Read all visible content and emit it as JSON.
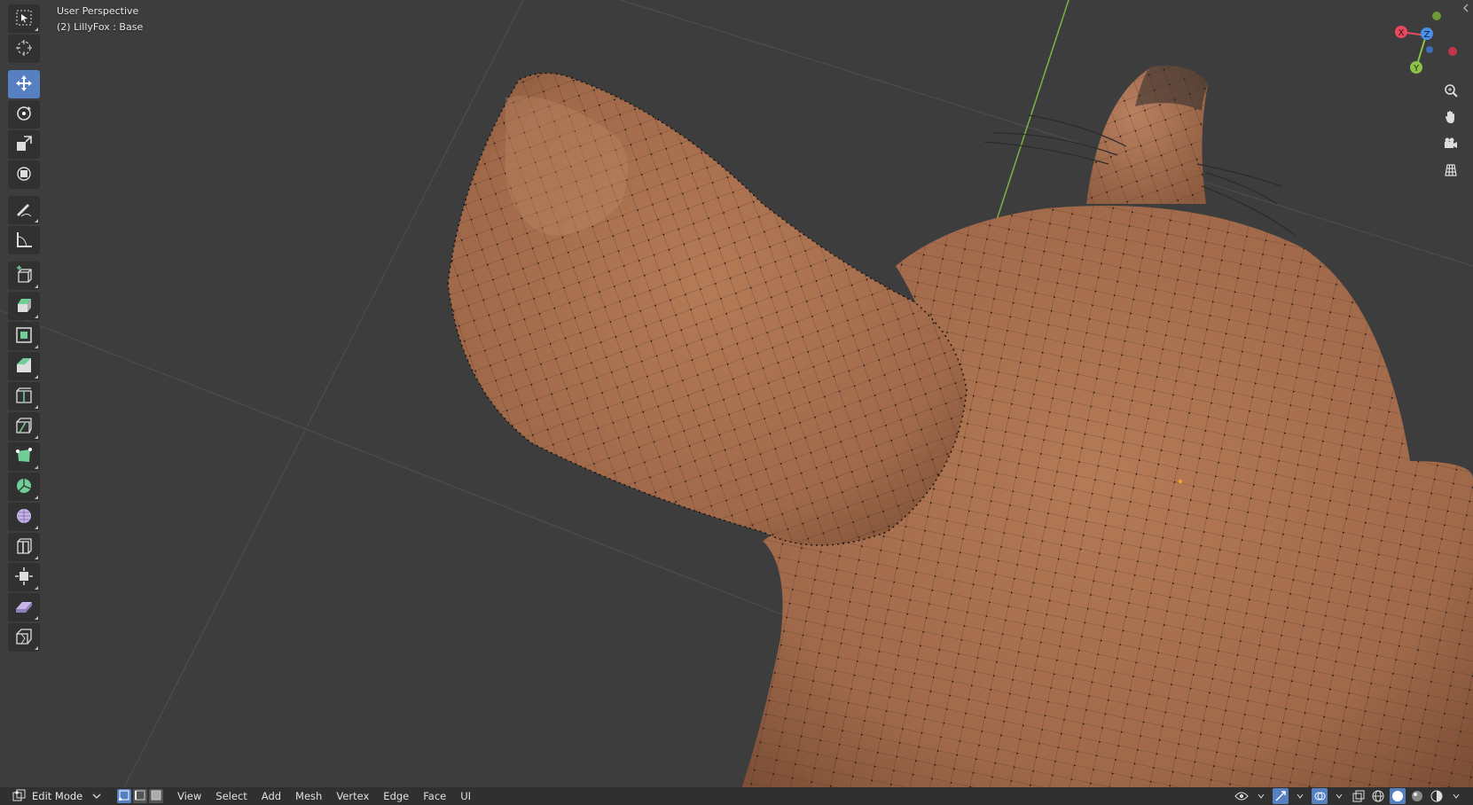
{
  "viewport": {
    "view_name": "User Perspective",
    "object_info": "(2) LillyFox : Base"
  },
  "gizmo": {
    "x_label": "X",
    "y_label": "Y",
    "z_label": "Z"
  },
  "toolbar": {
    "tools": [
      {
        "name": "select-box-tool",
        "icon": "select-box-icon"
      },
      {
        "name": "cursor-tool",
        "icon": "cursor-icon"
      },
      {
        "name": "move-tool",
        "icon": "move-icon",
        "active": true
      },
      {
        "name": "rotate-tool",
        "icon": "rotate-icon"
      },
      {
        "name": "scale-tool",
        "icon": "scale-icon"
      },
      {
        "name": "transform-tool",
        "icon": "transform-icon"
      },
      {
        "name": "annotate-tool",
        "icon": "annotate-icon"
      },
      {
        "name": "measure-tool",
        "icon": "measure-icon"
      },
      {
        "name": "add-cube-tool",
        "icon": "add-cube-icon"
      },
      {
        "name": "extrude-tool",
        "icon": "extrude-icon"
      },
      {
        "name": "inset-tool",
        "icon": "inset-icon"
      },
      {
        "name": "bevel-tool",
        "icon": "bevel-icon"
      },
      {
        "name": "loop-cut-tool",
        "icon": "loop-cut-icon"
      },
      {
        "name": "knife-tool",
        "icon": "knife-icon"
      },
      {
        "name": "poly-build-tool",
        "icon": "poly-build-icon"
      },
      {
        "name": "spin-tool",
        "icon": "spin-icon"
      },
      {
        "name": "smooth-tool",
        "icon": "smooth-icon"
      },
      {
        "name": "edge-slide-tool",
        "icon": "edge-slide-icon"
      },
      {
        "name": "shrink-fatten-tool",
        "icon": "shrink-fatten-icon"
      },
      {
        "name": "shear-tool",
        "icon": "shear-icon"
      },
      {
        "name": "rip-tool",
        "icon": "rip-icon"
      }
    ]
  },
  "header": {
    "mode": "Edit Mode",
    "menus": [
      "View",
      "Select",
      "Add",
      "Mesh",
      "Vertex",
      "Edge",
      "Face",
      "UI"
    ]
  },
  "colors": {
    "background": "#3d3d3d",
    "mesh_skin": "#a0694a",
    "active_tool": "#5680c2",
    "axis_x": "#e84a5f",
    "axis_y": "#8bc34a",
    "axis_z": "#4a8fe8"
  }
}
